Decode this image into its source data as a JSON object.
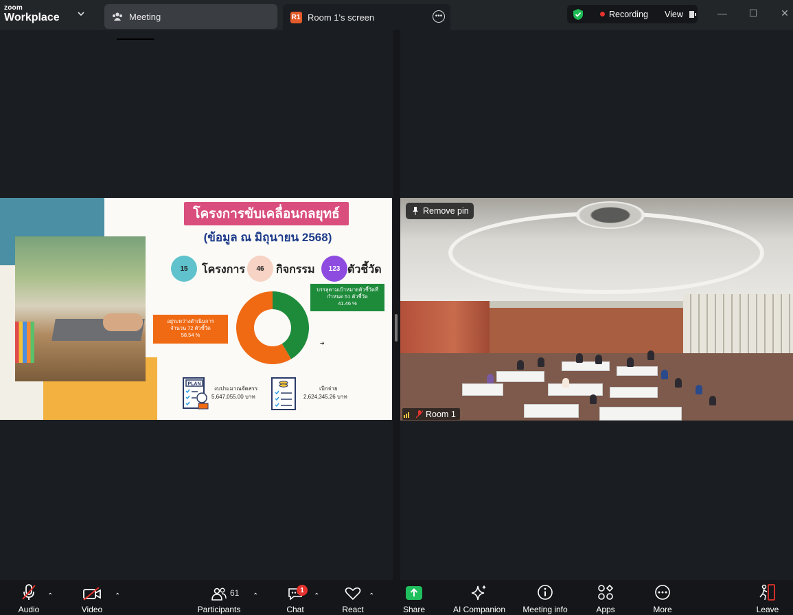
{
  "app": {
    "brand_small": "zoom",
    "brand_big": "Workplace"
  },
  "tabs": [
    {
      "label": "Meeting",
      "icon": "people-icon"
    },
    {
      "label": "Room 1's screen",
      "badge": "R1",
      "icon": "more-icon"
    }
  ],
  "recording": {
    "label": "Recording",
    "view_label": "View",
    "shield_color": "#1db954",
    "dot_color": "#e5322d"
  },
  "slide": {
    "title": "โครงการขับเคลื่อนกลยุทธ์",
    "subtitle": "(ข้อมูล ณ มิถุนายน 2568)",
    "stats": [
      {
        "value": "15",
        "label": "โครงการ"
      },
      {
        "value": "46",
        "label": "กิจกรรม"
      },
      {
        "value": "123",
        "label": "ตัวชี้วัด"
      }
    ],
    "orange_box": [
      "อยู่ระหว่างดำเนินการ",
      "จำนวน 72 ตัวชี้วัด",
      "58.54 %"
    ],
    "green_box": [
      "บรรลุตามเป้าหมายตัวชี้วัดที่",
      "กำหนด 51 ตัวชี้วัด",
      "41.46 %"
    ],
    "arrow": "➔",
    "budget_label": "งบประมาณจัดสรร",
    "budget_value": "5,647,055.00 บาท",
    "spent_label": "เบิกจ่าย",
    "spent_value": "2,624,345.26 บาท",
    "plan_tag": "PLAN"
  },
  "chart_data": {
    "type": "pie",
    "categories": [
      "อยู่ระหว่างดำเนินการ",
      "บรรลุตามเป้าหมาย"
    ],
    "values": [
      58.54,
      41.46
    ],
    "colors": [
      "#f06a14",
      "#1e8b3b"
    ]
  },
  "camera": {
    "remove_pin_label": "Remove pin",
    "name": "Room 1"
  },
  "toolbar": {
    "audio": "Audio",
    "video": "Video",
    "participants": "Participants",
    "participants_count": "61",
    "chat": "Chat",
    "chat_badge": "1",
    "react": "React",
    "share": "Share",
    "ai": "AI Companion",
    "meeting_info": "Meeting info",
    "apps": "Apps",
    "more": "More",
    "leave": "Leave"
  }
}
